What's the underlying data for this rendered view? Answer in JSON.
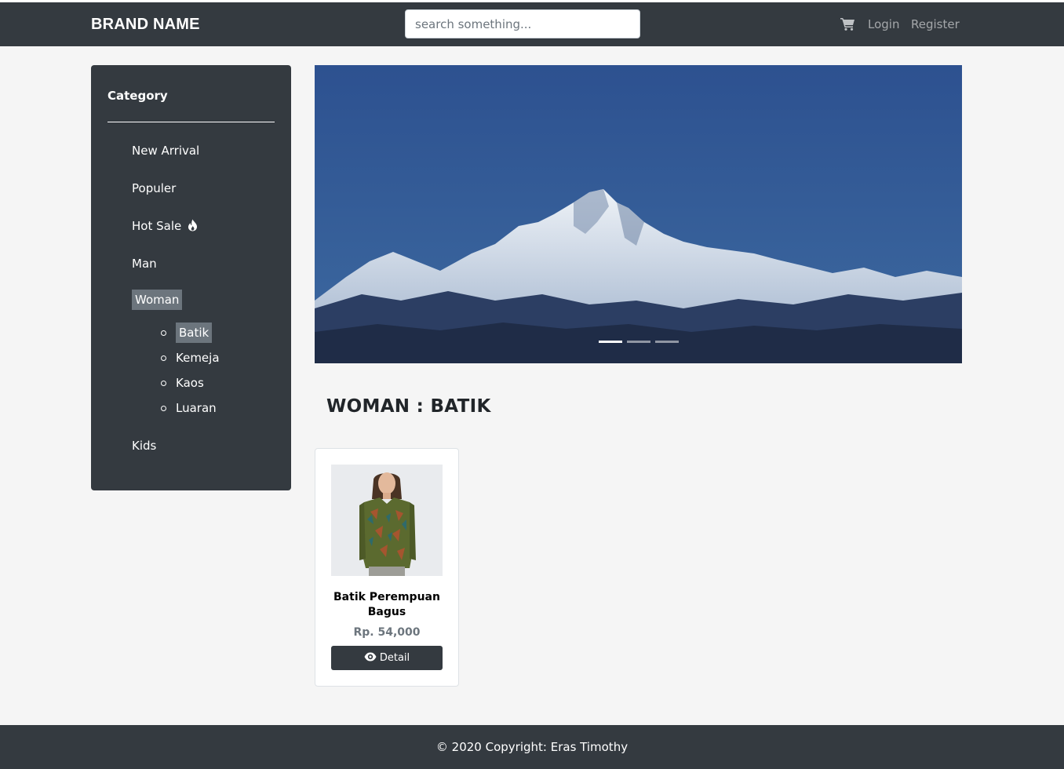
{
  "header": {
    "brand": "BRAND NAME",
    "search_placeholder": "search something...",
    "cart_icon": "shopping-cart-icon",
    "login_label": "Login",
    "register_label": "Register"
  },
  "sidebar": {
    "title": "Category",
    "items": [
      {
        "label": "New Arrival"
      },
      {
        "label": "Populer"
      },
      {
        "label": "Hot Sale",
        "icon": "fire-icon"
      },
      {
        "label": "Man"
      },
      {
        "label": "Woman",
        "active": true
      },
      {
        "label": "Kids"
      }
    ],
    "woman_subitems": [
      {
        "label": "Batik",
        "active": true
      },
      {
        "label": "Kemeja"
      },
      {
        "label": "Kaos"
      },
      {
        "label": "Luaran"
      }
    ]
  },
  "carousel": {
    "image": "snowy-mountain-range",
    "slide_count": 3,
    "active_slide": 1
  },
  "main": {
    "section_title": "WOMAN : BATIK",
    "products": [
      {
        "name": "Batik Perempuan Bagus",
        "price": "Rp. 54,000",
        "button_label": "Detail",
        "button_icon": "eye-icon",
        "image": "woman-in-batik-shirt"
      }
    ]
  },
  "footer": {
    "text": "© 2020 Copyright: Eras Timothy"
  },
  "colors": {
    "navbar": "#343a40",
    "page_bg": "#f5f5f5",
    "active_bg": "#6c757d",
    "sky": "#2f4f8a"
  }
}
